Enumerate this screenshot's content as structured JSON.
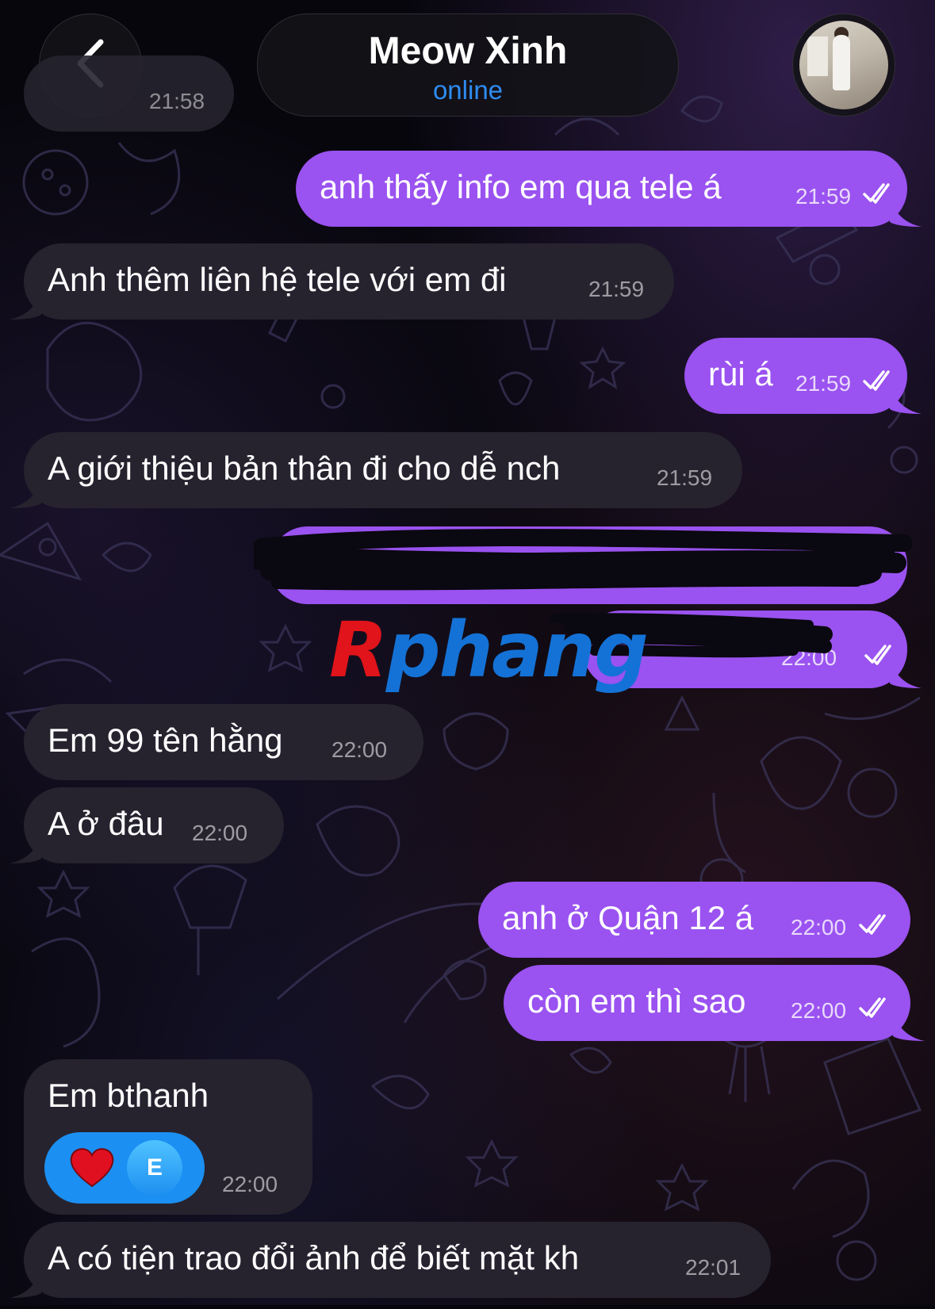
{
  "header": {
    "contact_name": "Meow Xinh",
    "status": "online",
    "back_icon": "chevron-left-icon",
    "avatar_icon": "contact-avatar"
  },
  "messages": [
    {
      "direction": "in",
      "text": "",
      "time": "21:58"
    },
    {
      "direction": "out",
      "text": "anh thấy info em qua tele á",
      "time": "21:59",
      "read": true
    },
    {
      "direction": "in",
      "text": "Anh thêm liên hệ tele với em đi",
      "time": "21:59"
    },
    {
      "direction": "out",
      "text": "rùi á",
      "time": "21:59",
      "read": true
    },
    {
      "direction": "in",
      "text": "A giới thiệu bản thân đi cho dễ nch",
      "time": "21:59"
    },
    {
      "direction": "out",
      "text": "",
      "redacted": true
    },
    {
      "direction": "out",
      "text": "",
      "redacted": true,
      "time": "22:00",
      "read": true
    },
    {
      "direction": "in",
      "text": "Em 99 tên hằng",
      "time": "22:00"
    },
    {
      "direction": "in",
      "text": "A ở đâu",
      "time": "22:00"
    },
    {
      "direction": "out",
      "text": "anh ở Quận 12 á",
      "time": "22:00",
      "read": true
    },
    {
      "direction": "out",
      "text": "còn em thì sao",
      "time": "22:00",
      "read": true
    },
    {
      "direction": "in",
      "text": "Em bthanh",
      "time": "22:00",
      "reaction": {
        "emoji": "heart-icon",
        "reactor_initial": "E"
      }
    },
    {
      "direction": "in",
      "text": "A có tiện trao đổi ảnh để biết mặt kh",
      "time": "22:01"
    }
  ],
  "watermark": {
    "first": "R",
    "rest": "phang"
  },
  "colors": {
    "outgoing_bubble": "#9a52f0",
    "incoming_bubble": "#26232f",
    "status_blue": "#2f8cf2",
    "reaction_blue": "#1b8ff2",
    "background": "#07060c"
  }
}
